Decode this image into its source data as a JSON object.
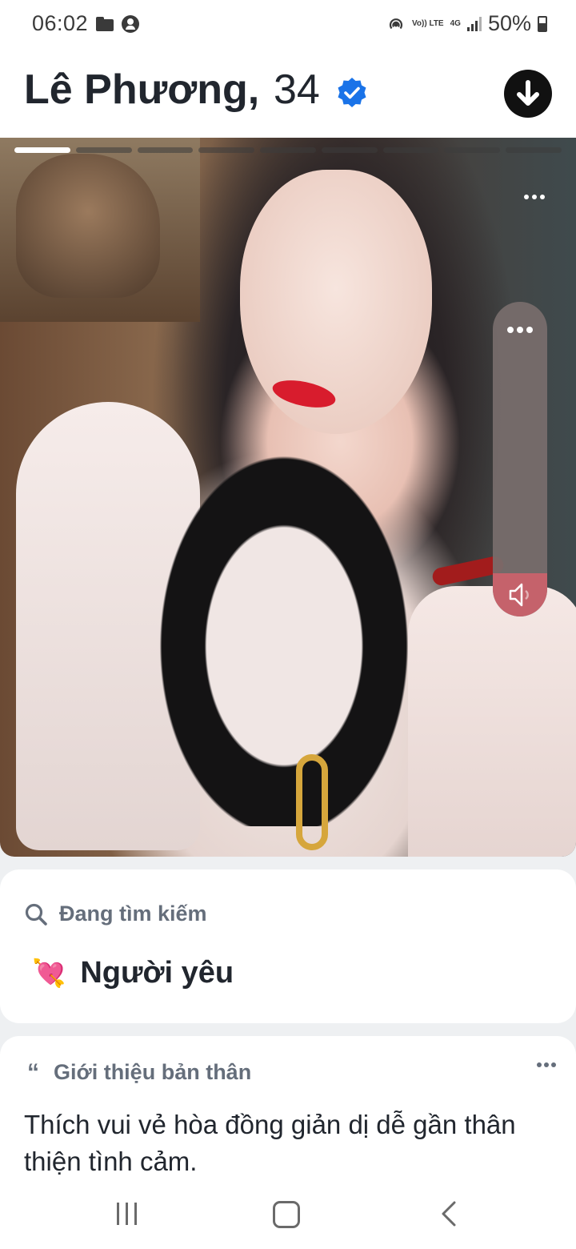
{
  "status_bar": {
    "time": "06:02",
    "battery_percent": "50%",
    "network": "4G",
    "volte": "Vo)) LTE",
    "icons": [
      "folder-icon",
      "account-icon",
      "hotspot-icon",
      "signal-icon",
      "battery-icon"
    ]
  },
  "profile": {
    "name": "Lê Phương,",
    "age": "34",
    "verified": true
  },
  "photo": {
    "total_photos": 9,
    "current_photo": 1
  },
  "looking_for": {
    "title": "Đang tìm kiếm",
    "emoji": "💘",
    "value": "Người yêu"
  },
  "about": {
    "title": "Giới thiệu bản thân",
    "text": "Thích vui vẻ hòa đồng giản dị dễ gần thân thiện tình cảm."
  },
  "colors": {
    "accent": "#1a73e8",
    "mute_button": "#c5626b",
    "text_primary": "#21262e",
    "text_secondary": "#656e7b"
  }
}
